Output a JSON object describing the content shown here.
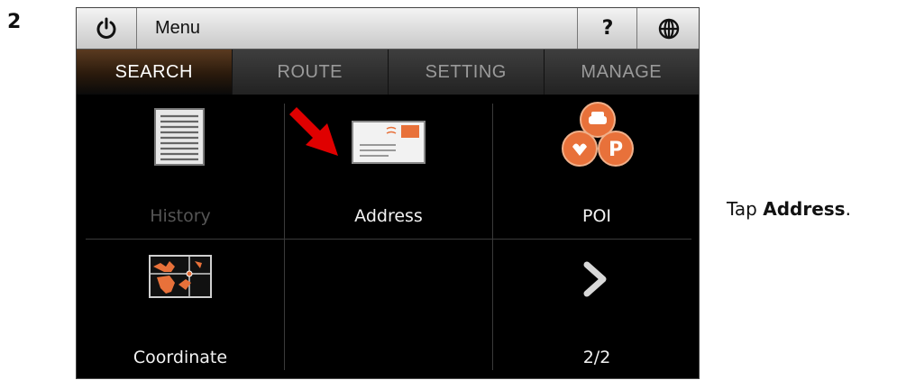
{
  "step": {
    "number": "2"
  },
  "topbar": {
    "menu_label": "Menu",
    "help_label": "?"
  },
  "tabs": [
    {
      "label": "SEARCH",
      "active": true
    },
    {
      "label": "ROUTE",
      "active": false
    },
    {
      "label": "SETTING",
      "active": false
    },
    {
      "label": "MANAGE",
      "active": false
    }
  ],
  "cells": {
    "history": {
      "label": "History",
      "enabled": false
    },
    "address": {
      "label": "Address"
    },
    "poi": {
      "label": "POI"
    },
    "coordinate": {
      "label": "Coordinate"
    },
    "page": {
      "label": "2/2"
    }
  },
  "instruction": {
    "prefix": "Tap ",
    "target": "Address",
    "suffix": "."
  },
  "icons": [
    "power-icon",
    "globe-icon",
    "history-icon",
    "address-icon",
    "poi-icon",
    "coordinate-icon",
    "chevron-right-icon",
    "red-arrow-pointer"
  ],
  "colors": {
    "accent_orange": "#e8713a",
    "pointer_red": "#e00000",
    "tab_active": "#3a2410"
  }
}
